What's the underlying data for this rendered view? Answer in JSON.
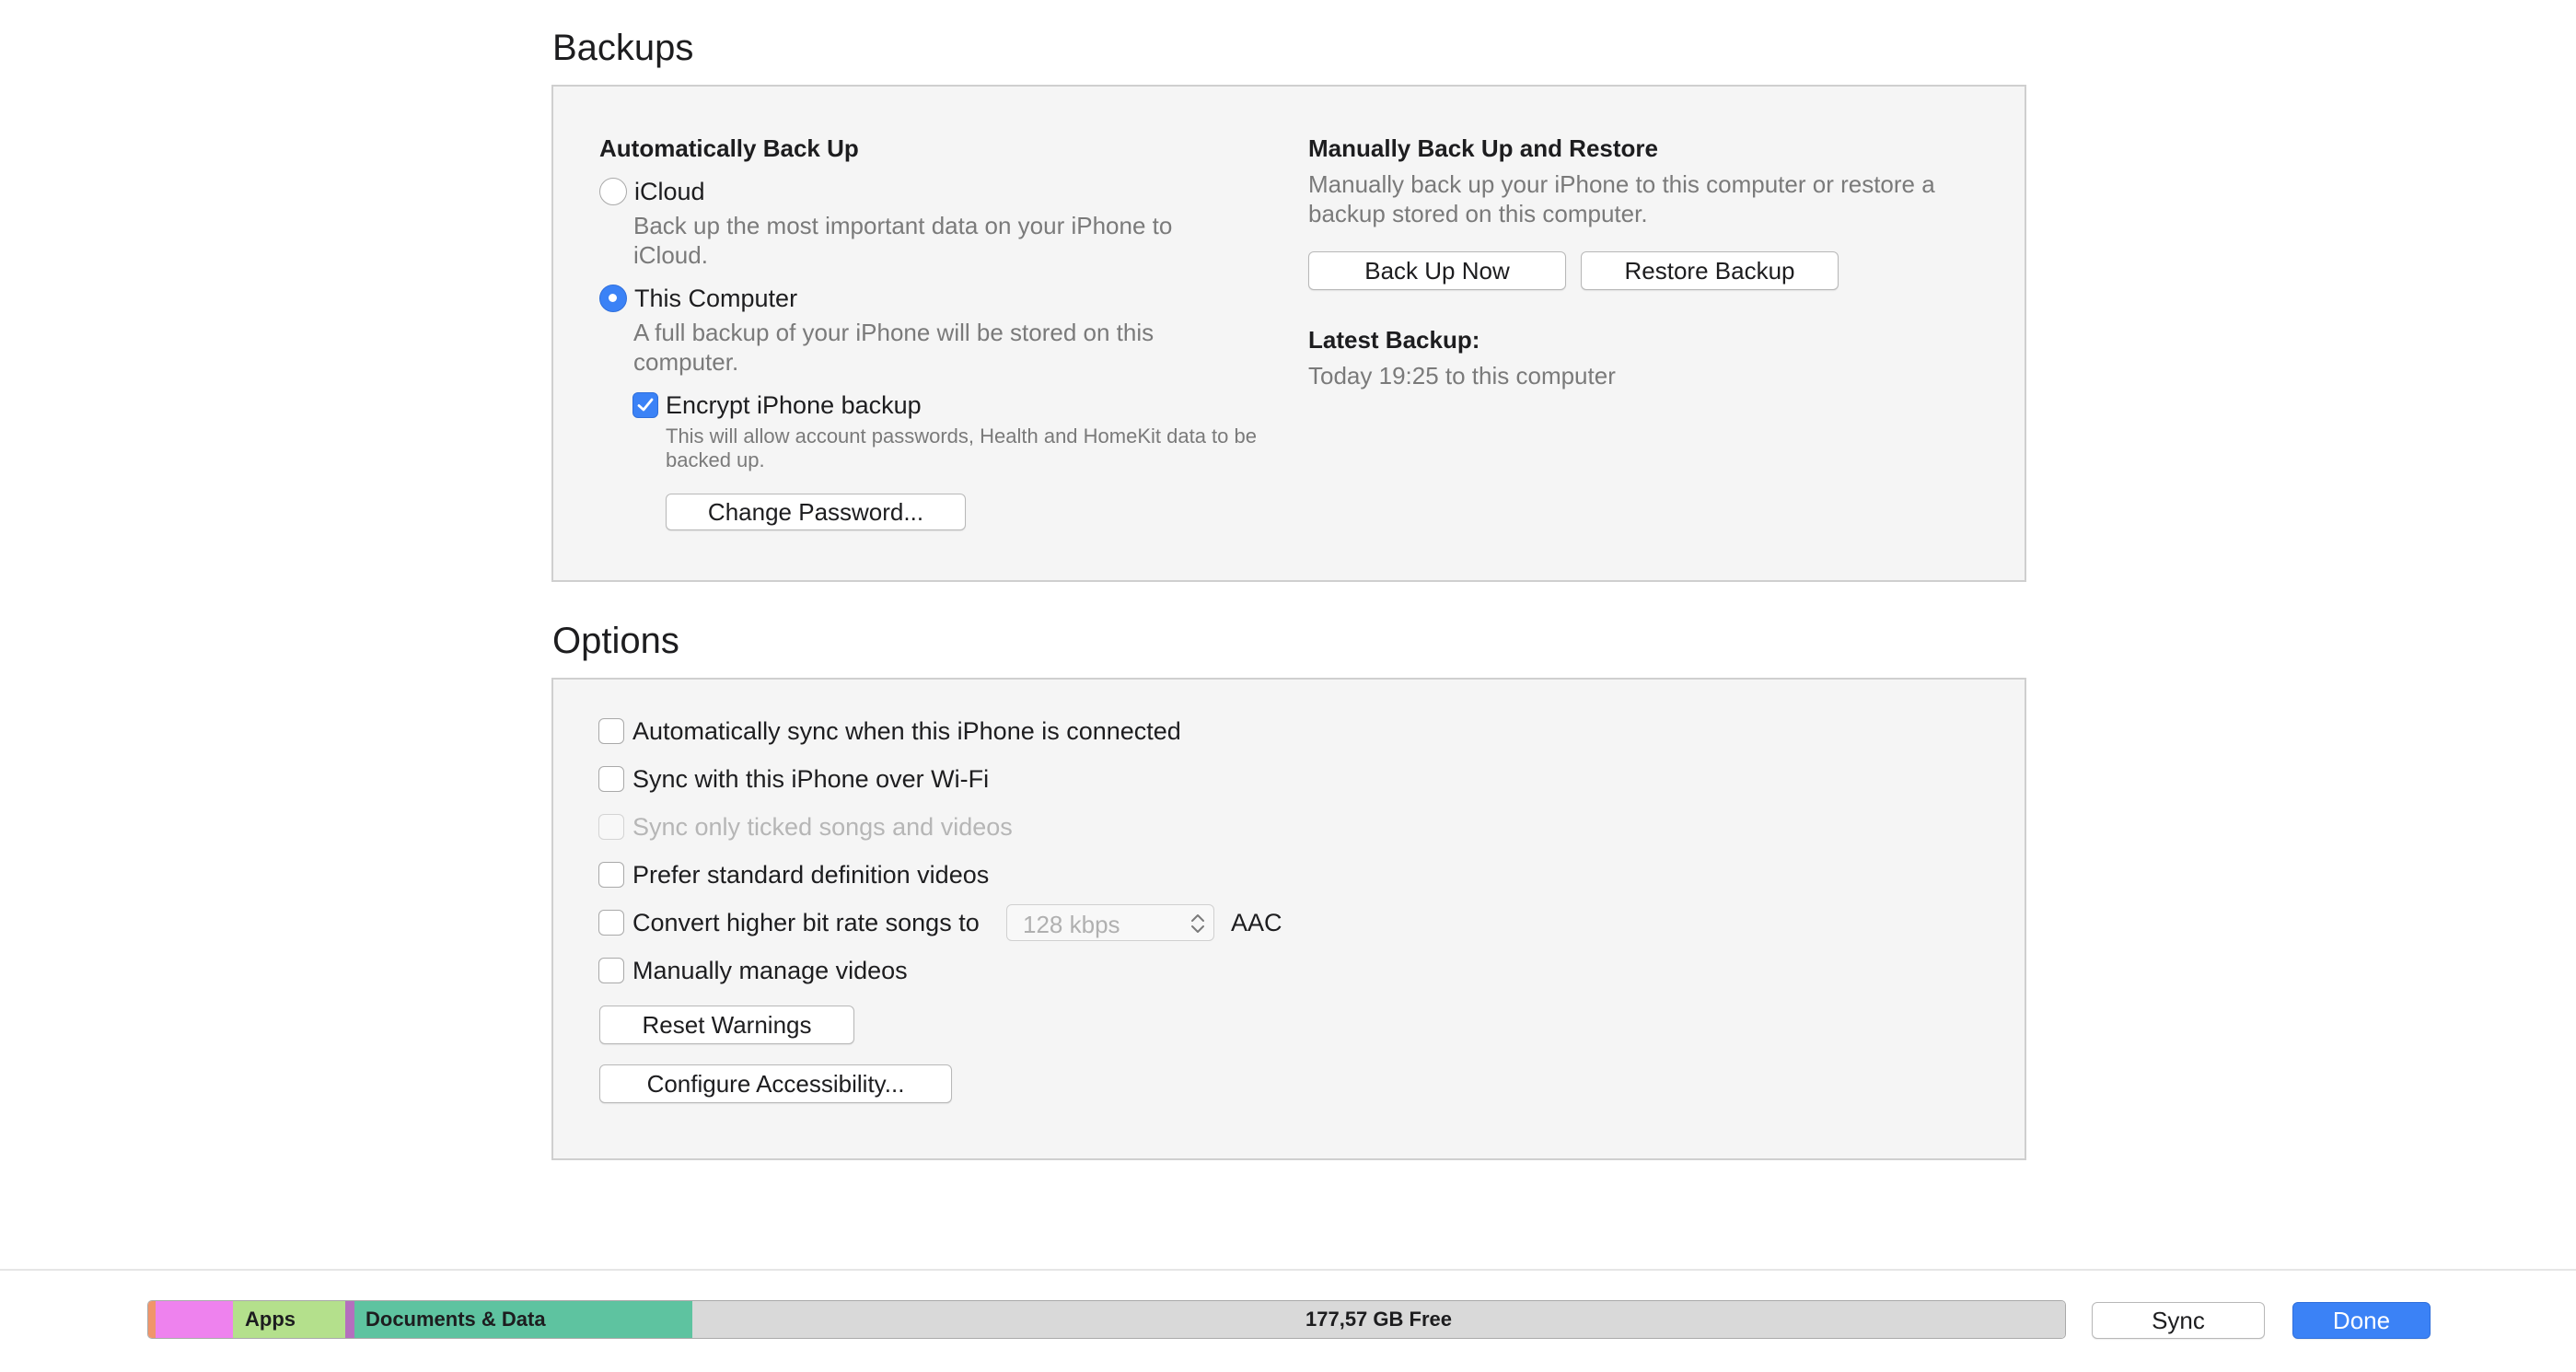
{
  "backups": {
    "title": "Backups",
    "auto": {
      "header": "Automatically Back Up",
      "icloud_label": "iCloud",
      "icloud_desc": "Back up the most important data on your iPhone to iCloud.",
      "computer_label": "This Computer",
      "computer_desc": "A full backup of your iPhone will be stored on this computer.",
      "encrypt_label": "Encrypt iPhone backup",
      "encrypt_desc": "This will allow account passwords, Health and HomeKit data to be backed up.",
      "change_password": "Change Password..."
    },
    "manual": {
      "header": "Manually Back Up and Restore",
      "desc": "Manually back up your iPhone to this computer or restore a backup stored on this computer.",
      "back_up_now": "Back Up Now",
      "restore_backup": "Restore Backup",
      "latest_header": "Latest Backup:",
      "latest_value": "Today 19:25 to this computer"
    },
    "selected": "This Computer",
    "encrypt_checked": true
  },
  "options": {
    "title": "Options",
    "items": [
      {
        "label": "Automatically sync when this iPhone is connected",
        "checked": false,
        "disabled": false
      },
      {
        "label": "Sync with this iPhone over Wi-Fi",
        "checked": false,
        "disabled": false
      },
      {
        "label": "Sync only ticked songs and videos",
        "checked": false,
        "disabled": true
      },
      {
        "label": "Prefer standard definition videos",
        "checked": false,
        "disabled": false
      },
      {
        "label": "Convert higher bit rate songs to",
        "checked": false,
        "disabled": false
      },
      {
        "label": "Manually manage videos",
        "checked": false,
        "disabled": false
      }
    ],
    "bitrate_value": "128 kbps",
    "bitrate_format": "AAC",
    "reset_warnings": "Reset Warnings",
    "configure_accessibility": "Configure Accessibility..."
  },
  "footer": {
    "storage": {
      "apps_label": "Apps",
      "docs_label": "Documents & Data",
      "free_label": "177,57 GB Free",
      "colors": {
        "orange": "#f0956a",
        "pink": "#ee82ee",
        "apps": "#b4e08c",
        "purple": "#b46fbe",
        "docs": "#5ec3a0",
        "free": "#d9d9d9"
      }
    },
    "sync": "Sync",
    "done": "Done",
    "accent": "#3b82f6"
  }
}
